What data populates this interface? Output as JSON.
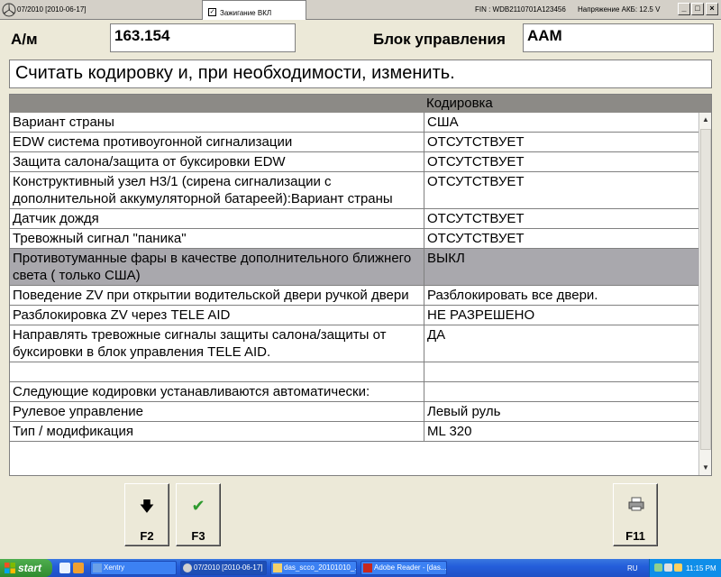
{
  "window": {
    "title": "07/2010 [2010-06-17]",
    "ignition_label": "Зажигание ВКЛ",
    "fin": "FIN : WDB2110701A123456",
    "battery": "Напряжение АКБ:  12.5 V"
  },
  "header": {
    "am_label": "А/м",
    "am_value": "163.154",
    "unit_label": "Блок управления",
    "unit_value": "AAM"
  },
  "instruction": "Считать кодировку и, при необходимости, изменить.",
  "table": {
    "col2_header": "Кодировка",
    "rows": [
      {
        "name": "Вариант страны",
        "value": "США"
      },
      {
        "name": "EDW система противоугонной сигнализации",
        "value": "ОТСУТСТВУЕТ"
      },
      {
        "name": "Защита салона/защита от буксировки EDW",
        "value": "ОТСУТСТВУЕТ"
      },
      {
        "name": "Конструктивный узел H3/1 (сирена сигнализации с дополнительной аккумуляторной батареей):Вариант страны",
        "value": "ОТСУТСТВУЕТ"
      },
      {
        "name": "Датчик дождя",
        "value": "ОТСУТСТВУЕТ"
      },
      {
        "name": "Тревожный сигнал \"паника\"",
        "value": "ОТСУТСТВУЕТ"
      },
      {
        "name": "Противотуманные фары в качестве дополнительного ближнего света ( только США)",
        "value": "ВЫКЛ"
      },
      {
        "name": "Поведение ZV при открытии водительской двери ручкой двери",
        "value": "Разблокировать все двери."
      },
      {
        "name": "Разблокировка ZV через TELE AID",
        "value": "НЕ РАЗРЕШЕНО"
      },
      {
        "name": "Направлять тревожные сигналы защиты салона/защиты от буксировки в блок управления TELE AID.",
        "value": "ДА"
      },
      {
        "name": "",
        "value": ""
      },
      {
        "name": "Следующие кодировки устанавливаются автоматически:",
        "value": ""
      },
      {
        "name": "Рулевое управление",
        "value": "Левый руль"
      },
      {
        "name": "Тип / модификация",
        "value": "ML 320"
      }
    ]
  },
  "buttons": {
    "f2": "F2",
    "f3": "F3",
    "f11": "F11"
  },
  "taskbar": {
    "start": "start",
    "items": [
      "Xentry",
      "07/2010 [2010-06-17]",
      "das_scco_20101010_...",
      "Adobe Reader - [das..."
    ],
    "lang": "RU",
    "clock": "11:15 PM"
  },
  "colors": {
    "header_bg": "#8c8a86",
    "selected_row": "#a9a8ad",
    "accent_green": "#2e9a2e"
  }
}
